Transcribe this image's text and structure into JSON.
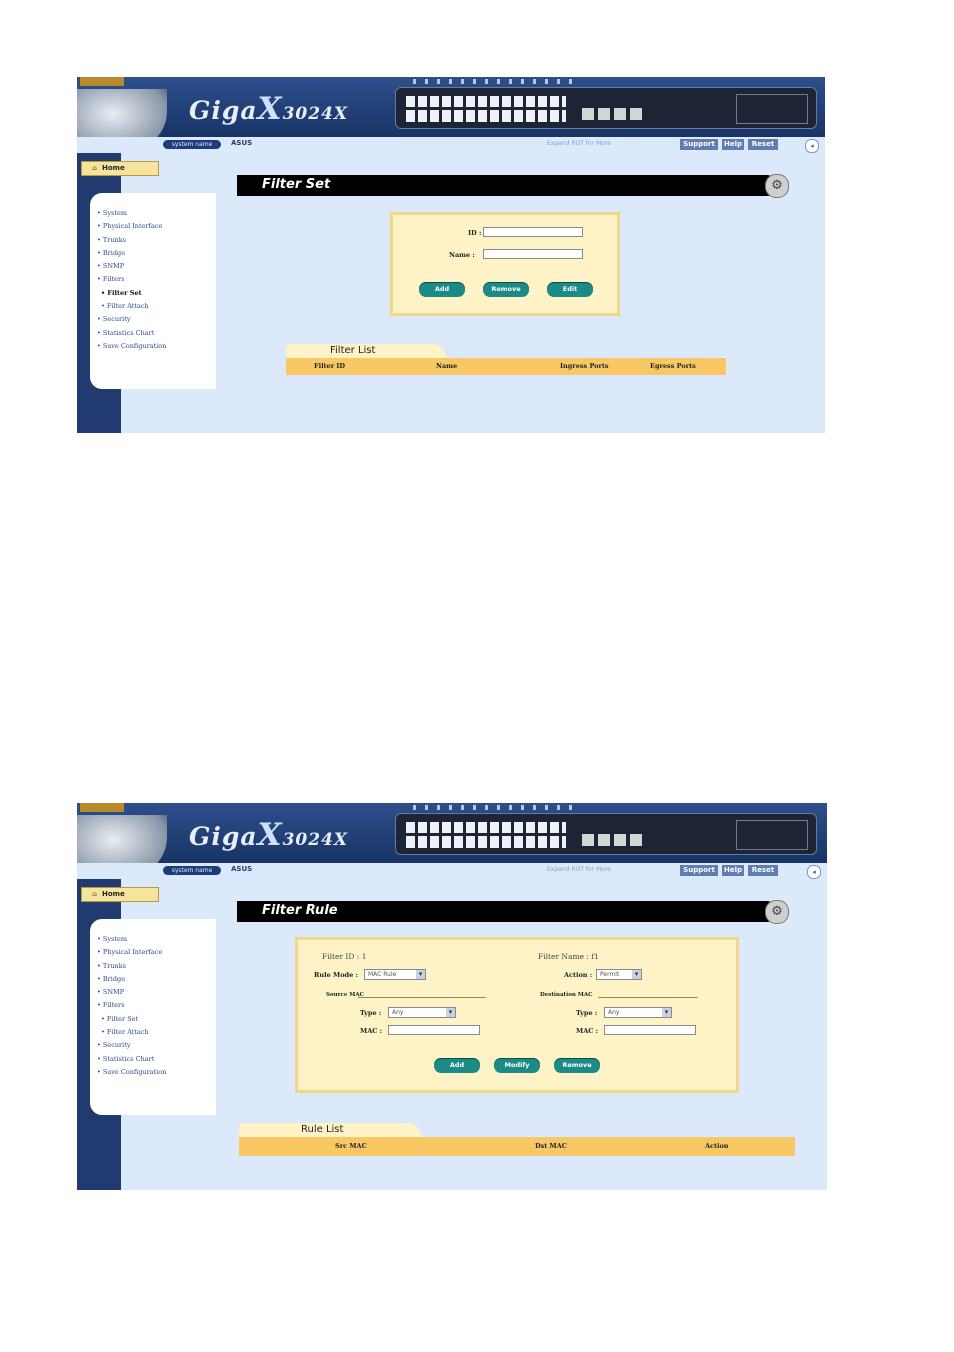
{
  "header": {
    "brand": "Giga",
    "brand_x": "X",
    "model": "3024X",
    "system_name_tag": "system name",
    "system_name": "ASUS",
    "status_message": "Expand ROT for More",
    "support_label": "Support",
    "help_label": "Help",
    "reset_label": "Reset"
  },
  "sidebar": {
    "home_label": "Home",
    "items": [
      "System",
      "Physical Interface",
      "Trunks",
      "Bridge",
      "SNMP",
      "Filters",
      "Filter Set",
      "Filter Attach",
      "Security",
      "Statistics Chart",
      "Save Configuration"
    ]
  },
  "filter_set": {
    "title": "Filter Set",
    "id_label": "ID :",
    "name_label": "Name :",
    "id_value": "",
    "name_value": "",
    "add_label": "Add",
    "remove_label": "Remove",
    "edit_label": "Edit",
    "list_title": "Filter List",
    "columns": [
      "Filter ID",
      "Name",
      "Ingress Ports",
      "Egress Ports"
    ]
  },
  "filter_rule": {
    "title": "Filter Rule",
    "filter_id_label": "Filter ID :",
    "filter_id_value": "1",
    "filter_name_label": "Filter Name :",
    "filter_name_value": "f1",
    "rule_mode_label": "Rule Mode :",
    "rule_mode_value": "MAC Rule",
    "action_label": "Action :",
    "action_value": "Permit",
    "source_mac_label": "Source MAC",
    "dest_mac_label": "Destination MAC",
    "src_type_label": "Type :",
    "src_type_value": "Any",
    "src_mac_label": "MAC :",
    "dst_type_label": "Type :",
    "dst_type_value": "Any",
    "dst_mac_label": "MAC :",
    "add_label": "Add",
    "modify_label": "Modify",
    "remove_label": "Remove",
    "list_title": "Rule List",
    "columns": [
      "Src MAC",
      "Dst MAC",
      "Action"
    ]
  }
}
